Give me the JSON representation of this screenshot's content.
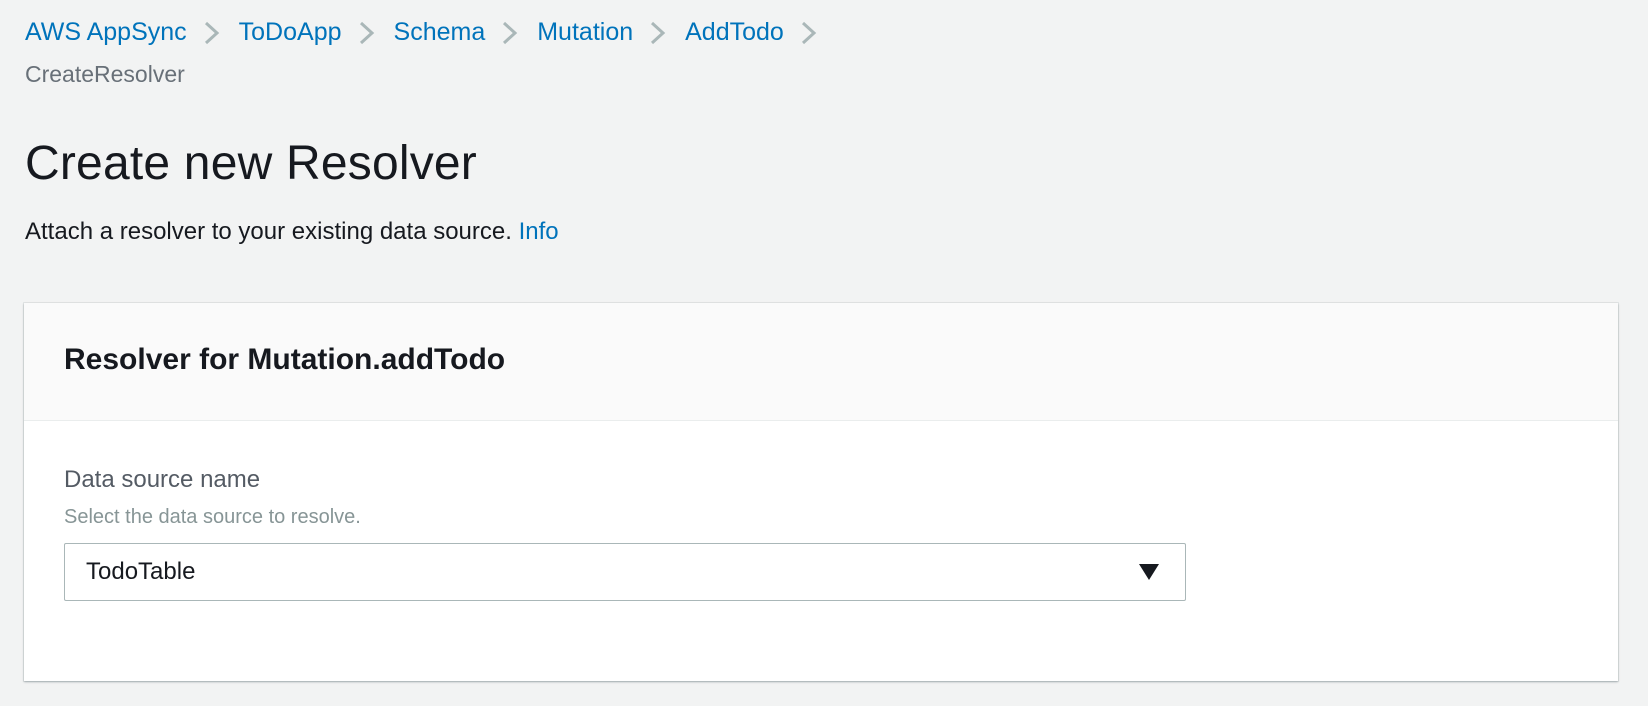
{
  "breadcrumb": {
    "items": [
      {
        "label": "AWS AppSync"
      },
      {
        "label": "ToDoApp"
      },
      {
        "label": "Schema"
      },
      {
        "label": "Mutation"
      },
      {
        "label": "AddTodo"
      }
    ],
    "current": "CreateResolver"
  },
  "page": {
    "title": "Create new Resolver",
    "description": "Attach a resolver to your existing data source.",
    "info_link": "Info"
  },
  "card": {
    "title": "Resolver for Mutation.addTodo",
    "field": {
      "label": "Data source name",
      "hint": "Select the data source to resolve.",
      "selected": "TodoTable"
    }
  },
  "icons": {
    "separator": "chevron-right-icon",
    "dropdown": "caret-down-icon"
  },
  "colors": {
    "link": "#0073bb",
    "background": "#f2f3f3",
    "text": "#16191f"
  }
}
